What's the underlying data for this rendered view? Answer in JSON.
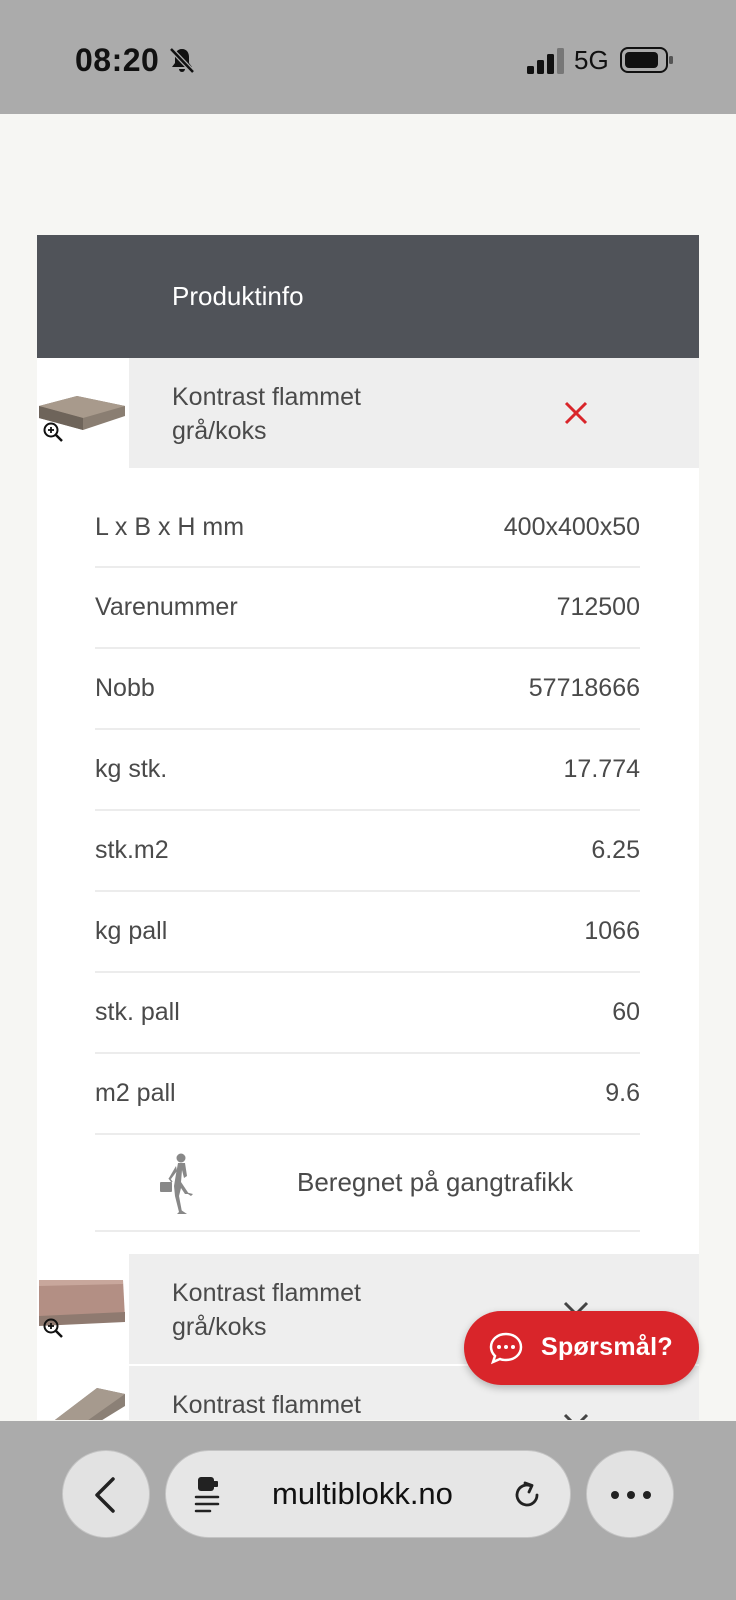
{
  "status_bar": {
    "time": "08:20",
    "network": "5G"
  },
  "panel": {
    "title": "Produktinfo",
    "selected_product": {
      "name": "Kontrast flammet grå/koks"
    },
    "specs": [
      {
        "label": "L x B x H mm",
        "value": "400x400x50"
      },
      {
        "label": "Varenummer",
        "value": "712500"
      },
      {
        "label": "Nobb",
        "value": "57718666"
      },
      {
        "label": "kg stk.",
        "value": "17.774"
      },
      {
        "label": "stk.m2",
        "value": "6.25"
      },
      {
        "label": "kg pall",
        "value": "1066"
      },
      {
        "label": "stk. pall",
        "value": "60"
      },
      {
        "label": "m2 pall",
        "value": "9.6"
      }
    ],
    "traffic_note": "Beregnet på gangtrafikk",
    "other_products": [
      {
        "name": "Kontrast flammet grå/koks"
      },
      {
        "name": "Kontrast flammet"
      }
    ]
  },
  "chat": {
    "label": "Spørsmål?"
  },
  "browser": {
    "url": "multiblokk.no"
  },
  "colors": {
    "header": "#505359",
    "accent": "#d9252a",
    "band": "#eeeeee"
  }
}
